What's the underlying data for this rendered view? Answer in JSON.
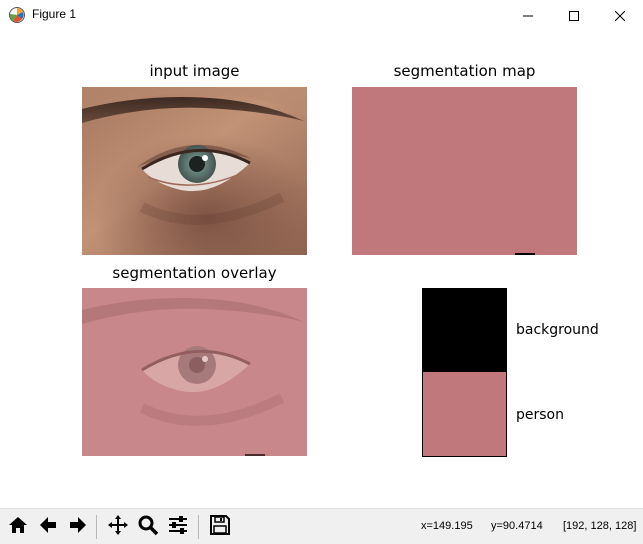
{
  "window": {
    "title": "Figure 1",
    "icons": {
      "app": "matplotlib-figure-icon",
      "minimize": "minimize-icon",
      "maximize": "maximize-icon",
      "close": "close-icon"
    }
  },
  "figure": {
    "panels": {
      "input": {
        "title": "input image"
      },
      "segmap": {
        "title": "segmentation map",
        "fill_color": "#c0787c"
      },
      "overlay": {
        "title": "segmentation overlay"
      }
    },
    "legend": {
      "items": [
        {
          "label": "background",
          "color": "#000000"
        },
        {
          "label": "person",
          "color": "#c0787c"
        }
      ]
    }
  },
  "toolbar": {
    "buttons": [
      "home-icon",
      "back-icon",
      "forward-icon",
      "pan-icon",
      "zoom-icon",
      "configure-subplots-icon",
      "save-icon"
    ],
    "status": {
      "x": "x=149.195",
      "y": "y=90.4714",
      "rgb": "[192, 128, 128]"
    }
  }
}
